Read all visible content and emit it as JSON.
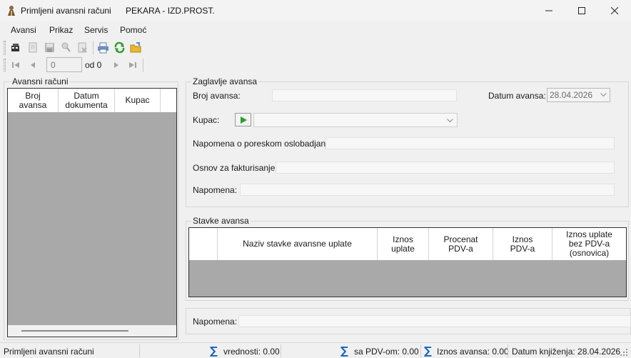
{
  "window": {
    "title": "Primljeni avansni računi",
    "company": "PEKARA - IZD.PROST."
  },
  "menu": [
    "Avansi",
    "Prikaz",
    "Servis",
    "Pomoć"
  ],
  "navigation": {
    "position_value": "0",
    "of_label": "od 0"
  },
  "left_panel": {
    "title": "Avansni računi",
    "columns": [
      "Broj\navansa",
      "Datum\ndokumenta",
      "Kupac"
    ]
  },
  "header_group": {
    "title": "Zaglavlje avansa",
    "broj_label": "Broj avansa:",
    "broj_value": "",
    "datum_label": "Datum avansa:",
    "datum_value": "28.04.2026",
    "kupac_label": "Kupac:",
    "kupac_value": "",
    "napomena_porez_label": "Napomena o poreskom oslobadjanju:",
    "osnov_label": "Osnov za fakturisanje:",
    "napomena_label": "Napomena:"
  },
  "items_group": {
    "title": "Stavke avansa",
    "columns": [
      "",
      "Naziv stavke avansne uplate",
      "Iznos\nuplate",
      "Procenat\nPDV-a",
      "Iznos\nPDV-a",
      "Iznos uplate\nbez PDV-a\n(osnovica)"
    ]
  },
  "footer": {
    "napomena_label": "Napomena:"
  },
  "status": {
    "caption": "Primljeni avansni računi",
    "vrednosti": "vrednosti: 0.00",
    "sa_pdv": "sa PDV-om:  0.00",
    "iznos_avansa": "Iznos avansa:  0.00",
    "datum_knjizenja": "Datum knjiženja: 28.04.2026"
  },
  "colors": {
    "grid_background": "#a9a9a9",
    "sigma": "#1560c0",
    "play_green": "#2e9e2e"
  }
}
